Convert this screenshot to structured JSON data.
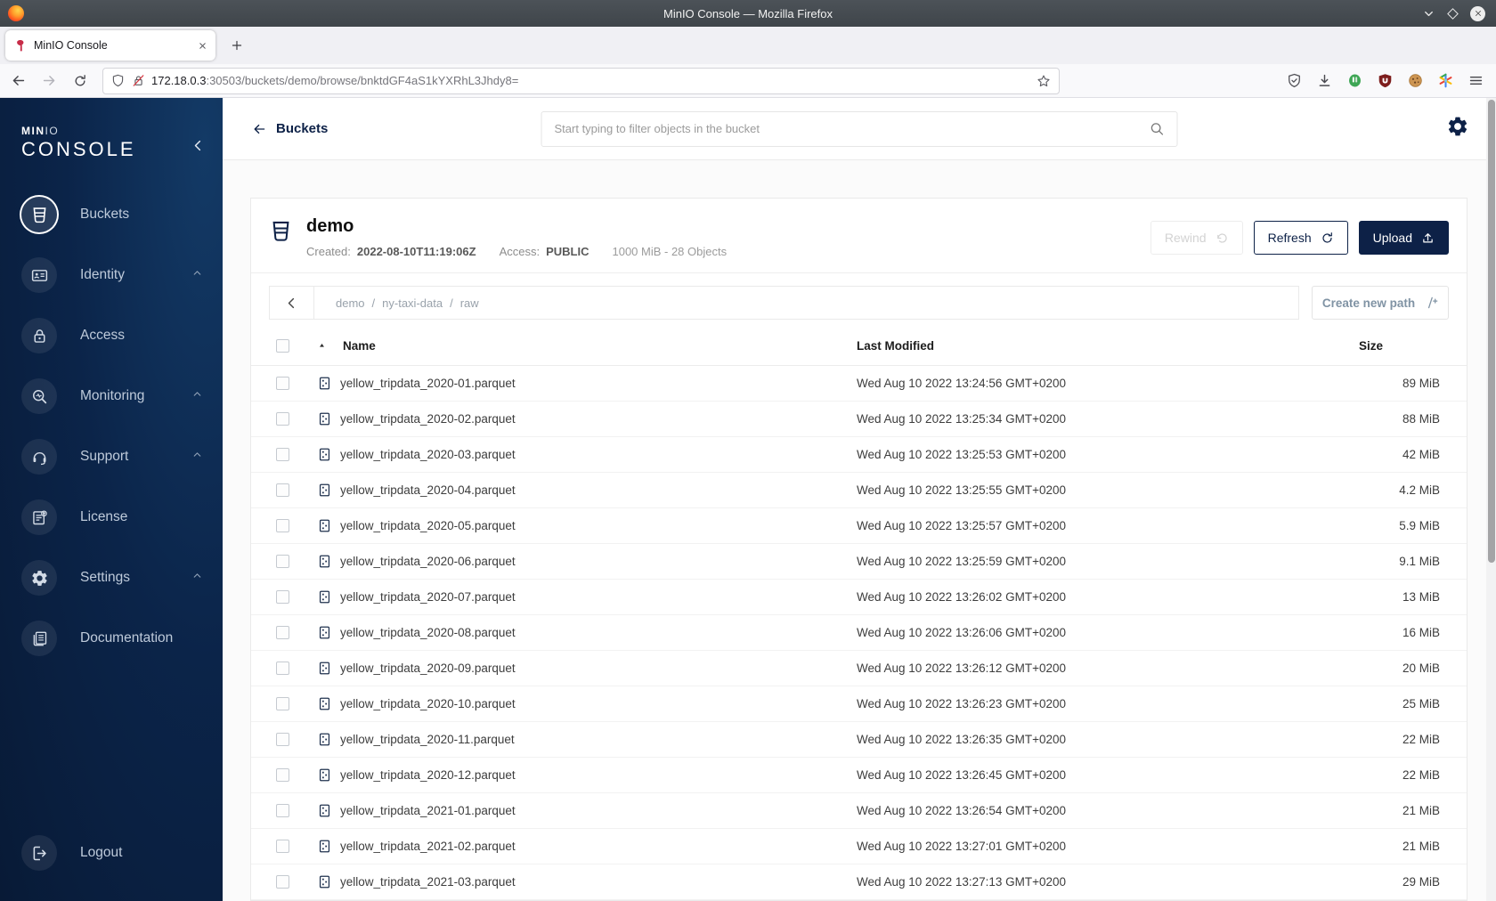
{
  "window": {
    "title": "MinIO Console — Mozilla Firefox"
  },
  "browser": {
    "tab_title": "MinIO Console",
    "url_host": "172.18.0.3",
    "url_rest": ":30503/buckets/demo/browse/bnktdGF4aS1kYXRhL3Jhdy8="
  },
  "sidebar": {
    "brand_bold": "MIN",
    "brand_light": "IO",
    "product": "CONSOLE",
    "items": [
      {
        "label": "Buckets",
        "active": true,
        "expandable": false
      },
      {
        "label": "Identity",
        "active": false,
        "expandable": true
      },
      {
        "label": "Access",
        "active": false,
        "expandable": false
      },
      {
        "label": "Monitoring",
        "active": false,
        "expandable": true
      },
      {
        "label": "Support",
        "active": false,
        "expandable": true
      },
      {
        "label": "License",
        "active": false,
        "expandable": false
      },
      {
        "label": "Settings",
        "active": false,
        "expandable": true
      },
      {
        "label": "Documentation",
        "active": false,
        "expandable": false
      }
    ],
    "logout_label": "Logout"
  },
  "topbar": {
    "back_label": "Buckets",
    "search_placeholder": "Start typing to filter objects in the bucket"
  },
  "bucket": {
    "name": "demo",
    "created_label": "Created:",
    "created_value": "2022-08-10T11:19:06Z",
    "access_label": "Access:",
    "access_value": "PUBLIC",
    "usage": "1000 MiB - 28 Objects",
    "rewind_label": "Rewind",
    "refresh_label": "Refresh",
    "upload_label": "Upload"
  },
  "pathbar": {
    "segments": [
      "demo",
      "ny-taxi-data",
      "raw"
    ],
    "separator": "/",
    "create_new_path_label": "Create new path"
  },
  "table": {
    "headers": {
      "name": "Name",
      "modified": "Last Modified",
      "size": "Size"
    },
    "rows": [
      {
        "name": "yellow_tripdata_2020-01.parquet",
        "modified": "Wed Aug 10 2022 13:24:56 GMT+0200",
        "size": "89 MiB"
      },
      {
        "name": "yellow_tripdata_2020-02.parquet",
        "modified": "Wed Aug 10 2022 13:25:34 GMT+0200",
        "size": "88 MiB"
      },
      {
        "name": "yellow_tripdata_2020-03.parquet",
        "modified": "Wed Aug 10 2022 13:25:53 GMT+0200",
        "size": "42 MiB"
      },
      {
        "name": "yellow_tripdata_2020-04.parquet",
        "modified": "Wed Aug 10 2022 13:25:55 GMT+0200",
        "size": "4.2 MiB"
      },
      {
        "name": "yellow_tripdata_2020-05.parquet",
        "modified": "Wed Aug 10 2022 13:25:57 GMT+0200",
        "size": "5.9 MiB"
      },
      {
        "name": "yellow_tripdata_2020-06.parquet",
        "modified": "Wed Aug 10 2022 13:25:59 GMT+0200",
        "size": "9.1 MiB"
      },
      {
        "name": "yellow_tripdata_2020-07.parquet",
        "modified": "Wed Aug 10 2022 13:26:02 GMT+0200",
        "size": "13 MiB"
      },
      {
        "name": "yellow_tripdata_2020-08.parquet",
        "modified": "Wed Aug 10 2022 13:26:06 GMT+0200",
        "size": "16 MiB"
      },
      {
        "name": "yellow_tripdata_2020-09.parquet",
        "modified": "Wed Aug 10 2022 13:26:12 GMT+0200",
        "size": "20 MiB"
      },
      {
        "name": "yellow_tripdata_2020-10.parquet",
        "modified": "Wed Aug 10 2022 13:26:23 GMT+0200",
        "size": "25 MiB"
      },
      {
        "name": "yellow_tripdata_2020-11.parquet",
        "modified": "Wed Aug 10 2022 13:26:35 GMT+0200",
        "size": "22 MiB"
      },
      {
        "name": "yellow_tripdata_2020-12.parquet",
        "modified": "Wed Aug 10 2022 13:26:45 GMT+0200",
        "size": "22 MiB"
      },
      {
        "name": "yellow_tripdata_2021-01.parquet",
        "modified": "Wed Aug 10 2022 13:26:54 GMT+0200",
        "size": "21 MiB"
      },
      {
        "name": "yellow_tripdata_2021-02.parquet",
        "modified": "Wed Aug 10 2022 13:27:01 GMT+0200",
        "size": "21 MiB"
      },
      {
        "name": "yellow_tripdata_2021-03.parquet",
        "modified": "Wed Aug 10 2022 13:27:13 GMT+0200",
        "size": "29 MiB"
      }
    ]
  },
  "colors": {
    "navy": "#0d2147",
    "brand-red": "#c72c48",
    "sidebar-1": "#133a66",
    "sidebar-2": "#0b2449",
    "sidebar-3": "#081a36",
    "page-bg": "#fbfbfb",
    "disabled": "#d3d3d3"
  }
}
